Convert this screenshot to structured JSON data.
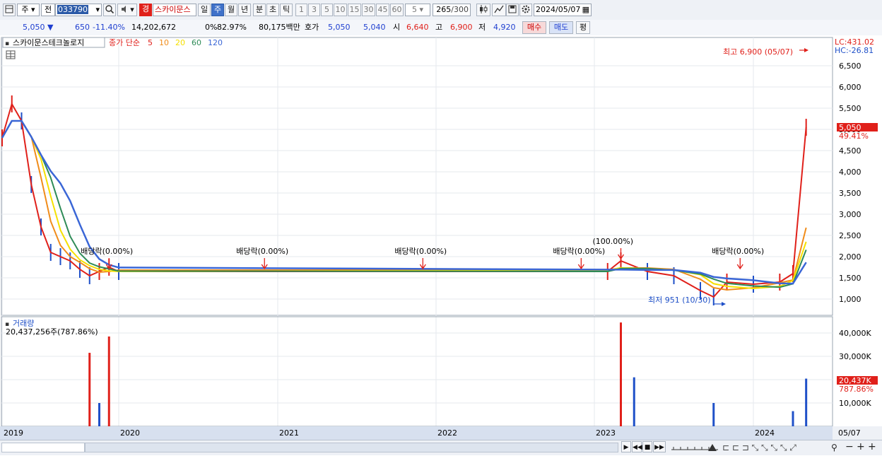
{
  "toolbar": {
    "market_type": "주",
    "chart_kind": "전",
    "stock_code": "033790",
    "stock_name": "스카이문스",
    "pill_label": "경",
    "periods": [
      "일",
      "주",
      "월",
      "년"
    ],
    "active_period": "주",
    "intervals": [
      "분",
      "초",
      "틱"
    ],
    "minute_options": [
      "1",
      "3",
      "5",
      "10",
      "15",
      "30",
      "45",
      "60"
    ],
    "minute_select": "5",
    "count_value": "265",
    "count_total": "/300",
    "date_value": "2024/05/07"
  },
  "quote": {
    "price": "5,050",
    "change": "650",
    "change_pct": "-11.40%",
    "volume": "14,202,672",
    "ratio_0": "0%",
    "ratio_1": "82.97%",
    "amount": "80,175백만",
    "bid_label": "호가",
    "ask": "5,050",
    "bid": "5,040",
    "open_label": "시",
    "open": "6,640",
    "high_label": "고",
    "high": "6,900",
    "low_label": "저",
    "low": "4,920",
    "buy_button": "매수",
    "sell_button": "매도",
    "extra_button": "평"
  },
  "chart_data": {
    "type": "line",
    "stock_label": "스카이문스테크놀로지",
    "legend_prefix": "종가 단순",
    "ma_periods": [
      "5",
      "10",
      "20",
      "60",
      "120"
    ],
    "ma_colors": [
      "#e0201a",
      "#f08c1a",
      "#f5e000",
      "#2e8b57",
      "#3a66d6"
    ],
    "candle_up": "#e0201a",
    "candle_down": "#1f50c8",
    "lc_label": "LC:431.02",
    "hc_label": "HC:-26.81",
    "price_ticks": [
      "6,500",
      "6,000",
      "5,500",
      "5,000",
      "4,500",
      "4,000",
      "3,500",
      "3,000",
      "2,500",
      "2,000",
      "1,500",
      "1,000"
    ],
    "price_tick_values": [
      6500,
      6000,
      5500,
      5000,
      4500,
      4000,
      3500,
      3000,
      2500,
      2000,
      1500,
      1000
    ],
    "current_price_tag": "5,050",
    "current_pct_tag": "49.41%",
    "high_annotation": "최고 6,900 (05/07)",
    "low_annotation": "최저 951 (10/30)",
    "events": [
      {
        "label": "배당락(0.00%)",
        "date": "2019-12"
      },
      {
        "label": "배당락(0.00%)",
        "date": "2020-12"
      },
      {
        "label": "배당락(0.00%)",
        "date": "2021-12"
      },
      {
        "label": "배당락(0.00%)",
        "date": "2022-12"
      },
      {
        "label": "(100.00%)",
        "date": "2023-03"
      },
      {
        "label": "배당락(0.00%)",
        "date": "2023-12"
      }
    ],
    "x_labels": [
      "2019",
      "2020",
      "2021",
      "2022",
      "2023",
      "2024"
    ],
    "x_last_label": "05/07",
    "price_series": [
      {
        "date": "2019-01",
        "close": 4800
      },
      {
        "date": "2019-02",
        "close": 5600
      },
      {
        "date": "2019-03",
        "close": 5200
      },
      {
        "date": "2019-04",
        "close": 3700
      },
      {
        "date": "2019-05",
        "close": 2700
      },
      {
        "date": "2019-06",
        "close": 2100
      },
      {
        "date": "2019-07",
        "close": 2000
      },
      {
        "date": "2019-08",
        "close": 1900
      },
      {
        "date": "2019-09",
        "close": 1700
      },
      {
        "date": "2019-10",
        "close": 1550
      },
      {
        "date": "2019-11",
        "close": 1650
      },
      {
        "date": "2019-12",
        "close": 1750
      },
      {
        "date": "2020-01",
        "close": 1650
      },
      {
        "date": "2023-02",
        "close": 1650
      },
      {
        "date": "2023-03",
        "close": 1900
      },
      {
        "date": "2023-05",
        "close": 1650
      },
      {
        "date": "2023-07",
        "close": 1550
      },
      {
        "date": "2023-09",
        "close": 1200
      },
      {
        "date": "2023-10",
        "close": 1050
      },
      {
        "date": "2023-11",
        "close": 1400
      },
      {
        "date": "2024-01",
        "close": 1350
      },
      {
        "date": "2024-03",
        "close": 1400
      },
      {
        "date": "2024-04",
        "close": 1600
      },
      {
        "date": "2024-05",
        "close": 5050
      }
    ],
    "volume_title": "거래량",
    "volume_summary": "20,437,256주(787.86%)",
    "volume_ticks": [
      "40,000K",
      "30,000K",
      "20,000K",
      "10,000K"
    ],
    "volume_tick_values": [
      40000,
      30000,
      20000,
      10000
    ],
    "volume_tag": "20,437K",
    "volume_pct_tag": "787.86%",
    "volume_series": [
      {
        "date": "2019-10",
        "value": 31500
      },
      {
        "date": "2019-11",
        "value": 10000
      },
      {
        "date": "2019-12",
        "value": 38500
      },
      {
        "date": "2023-03",
        "value": 44500
      },
      {
        "date": "2023-04",
        "value": 21000
      },
      {
        "date": "2023-10",
        "value": 10000
      },
      {
        "date": "2024-04",
        "value": 6500
      },
      {
        "date": "2024-05",
        "value": 20437
      }
    ]
  }
}
